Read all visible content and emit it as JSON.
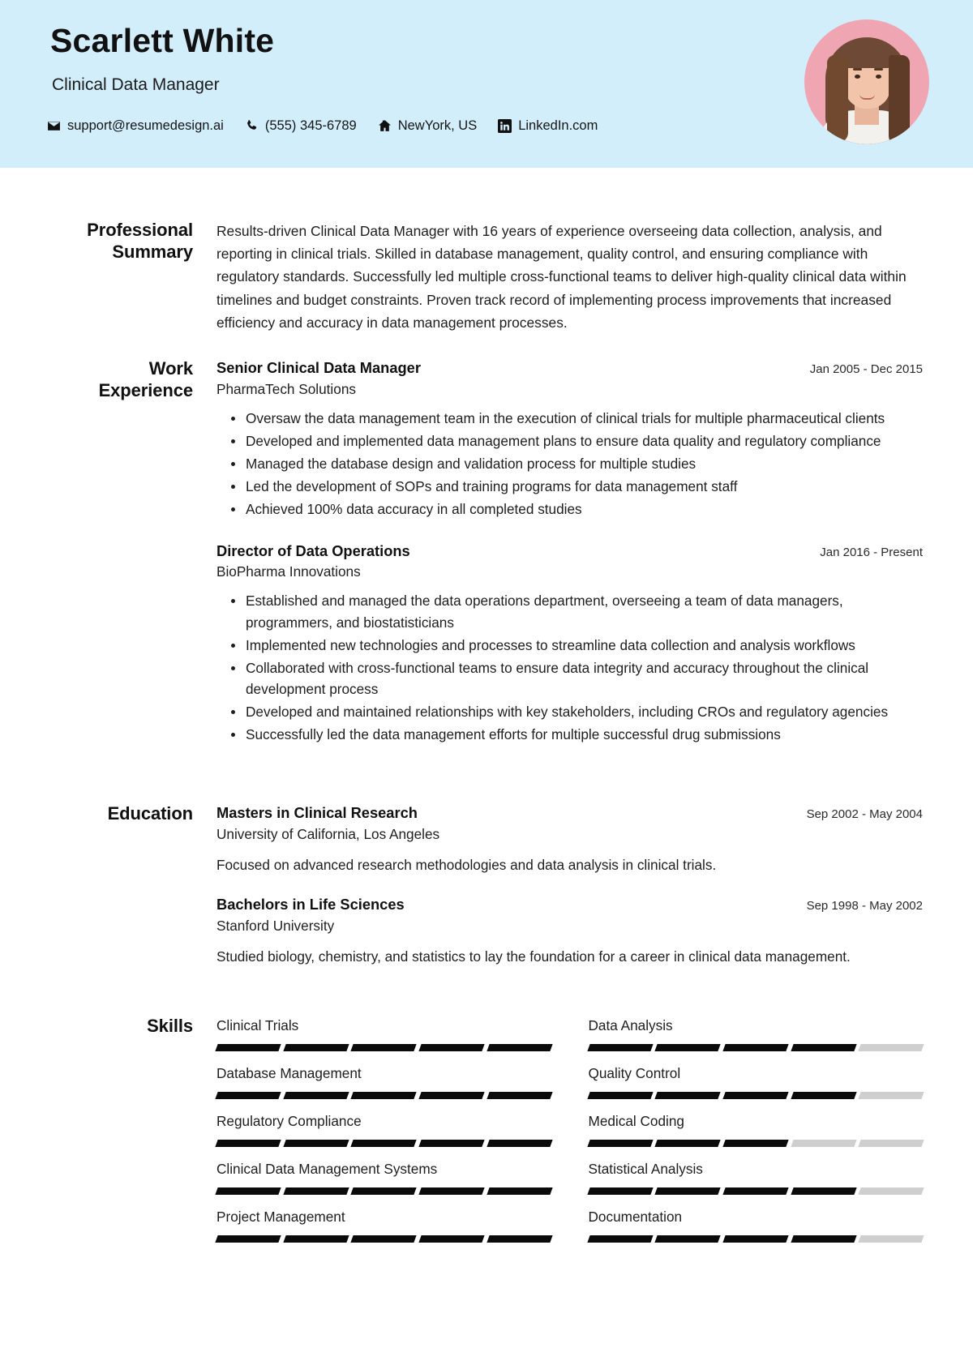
{
  "theme": {
    "header_bg": "#d3eefb",
    "avatar_bg": "#f0a5b2",
    "bar_filled": "#0b0b0b",
    "bar_empty": "#cfcfcf",
    "text": "#1e1e1e"
  },
  "header": {
    "name": "Scarlett White",
    "role": "Clinical Data Manager",
    "contacts": [
      {
        "icon": "email-icon",
        "text": "support@resumedesign.ai"
      },
      {
        "icon": "phone-icon",
        "text": "(555) 345-6789"
      },
      {
        "icon": "home-icon",
        "text": "NewYork, US"
      },
      {
        "icon": "linkedin-icon",
        "text": "LinkedIn.com"
      }
    ],
    "avatar_alt": "profile-photo"
  },
  "summary": {
    "label": "Professional Summary",
    "text": "Results-driven Clinical Data Manager with 16 years of experience overseeing data collection, analysis, and reporting in clinical trials. Skilled in database management, quality control, and ensuring compliance with regulatory standards. Successfully led multiple cross-functional teams to deliver high-quality clinical data within timelines and budget constraints. Proven track record of implementing process improvements that increased efficiency and accuracy in data management processes."
  },
  "work": {
    "label": "Work Experience",
    "jobs": [
      {
        "title": "Senior Clinical Data Manager",
        "company": "PharmaTech Solutions",
        "dates": "Jan 2005 - Dec 2015",
        "bullets": [
          "Oversaw the data management team in the execution of clinical trials for multiple pharmaceutical clients",
          "Developed and implemented data management plans to ensure data quality and regulatory compliance",
          "Managed the database design and validation process for multiple studies",
          "Led the development of SOPs and training programs for data management staff",
          "Achieved 100% data accuracy in all completed studies"
        ]
      },
      {
        "title": "Director of Data Operations",
        "company": "BioPharma Innovations",
        "dates": "Jan 2016 - Present",
        "bullets": [
          "Established and managed the data operations department, overseeing a team of data managers, programmers, and biostatisticians",
          "Implemented new technologies and processes to streamline data collection and analysis workflows",
          "Collaborated with cross-functional teams to ensure data integrity and accuracy throughout the clinical development process",
          "Developed and maintained relationships with key stakeholders, including CROs and regulatory agencies",
          "Successfully led the data management efforts for multiple successful drug submissions"
        ]
      }
    ]
  },
  "education": {
    "label": "Education",
    "items": [
      {
        "degree": "Masters in Clinical Research",
        "school": "University of California, Los Angeles",
        "dates": "Sep 2002 - May 2004",
        "description": "Focused on advanced research methodologies and data analysis in clinical trials."
      },
      {
        "degree": "Bachelors in Life Sciences",
        "school": "Stanford University",
        "dates": "Sep 1998 - May 2002",
        "description": "Studied biology, chemistry, and statistics to lay the foundation for a career in clinical data management."
      }
    ]
  },
  "skills": {
    "label": "Skills",
    "segments_total": 5,
    "items": [
      {
        "name": "Clinical Trials",
        "level": 5
      },
      {
        "name": "Data Analysis",
        "level": 4
      },
      {
        "name": "Database Management",
        "level": 5
      },
      {
        "name": "Quality Control",
        "level": 4
      },
      {
        "name": "Regulatory Compliance",
        "level": 5
      },
      {
        "name": "Medical Coding",
        "level": 3
      },
      {
        "name": "Clinical Data Management Systems",
        "level": 5
      },
      {
        "name": "Statistical Analysis",
        "level": 4
      },
      {
        "name": "Project Management",
        "level": 5
      },
      {
        "name": "Documentation",
        "level": 4
      }
    ]
  }
}
